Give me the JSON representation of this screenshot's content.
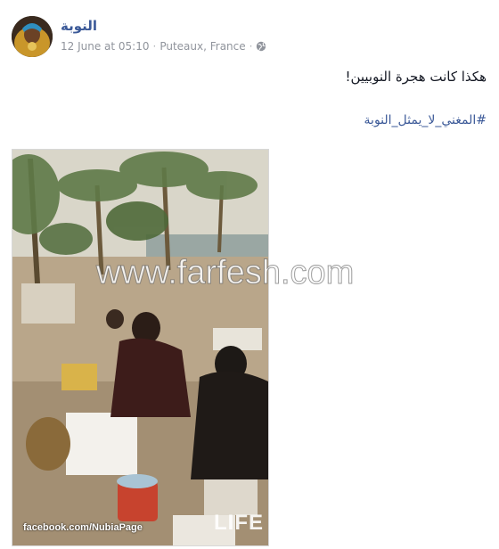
{
  "post": {
    "author_name": "النوبة",
    "timestamp": "12 June at 05:10",
    "location": "Puteaux, France",
    "meta_separator": "·",
    "audience_icon": "globe-icon",
    "message": "هكذا كانت هجرة النوبيين!",
    "hashtag": "#المغني_لا_يمثل_النوبة"
  },
  "photo": {
    "watermark": "www.farfesh.com",
    "credit": "facebook.com/NubiaPage",
    "publisher_mark": "LIFE"
  },
  "colors": {
    "link": "#3b5998",
    "meta": "#90949c",
    "text": "#141823"
  }
}
